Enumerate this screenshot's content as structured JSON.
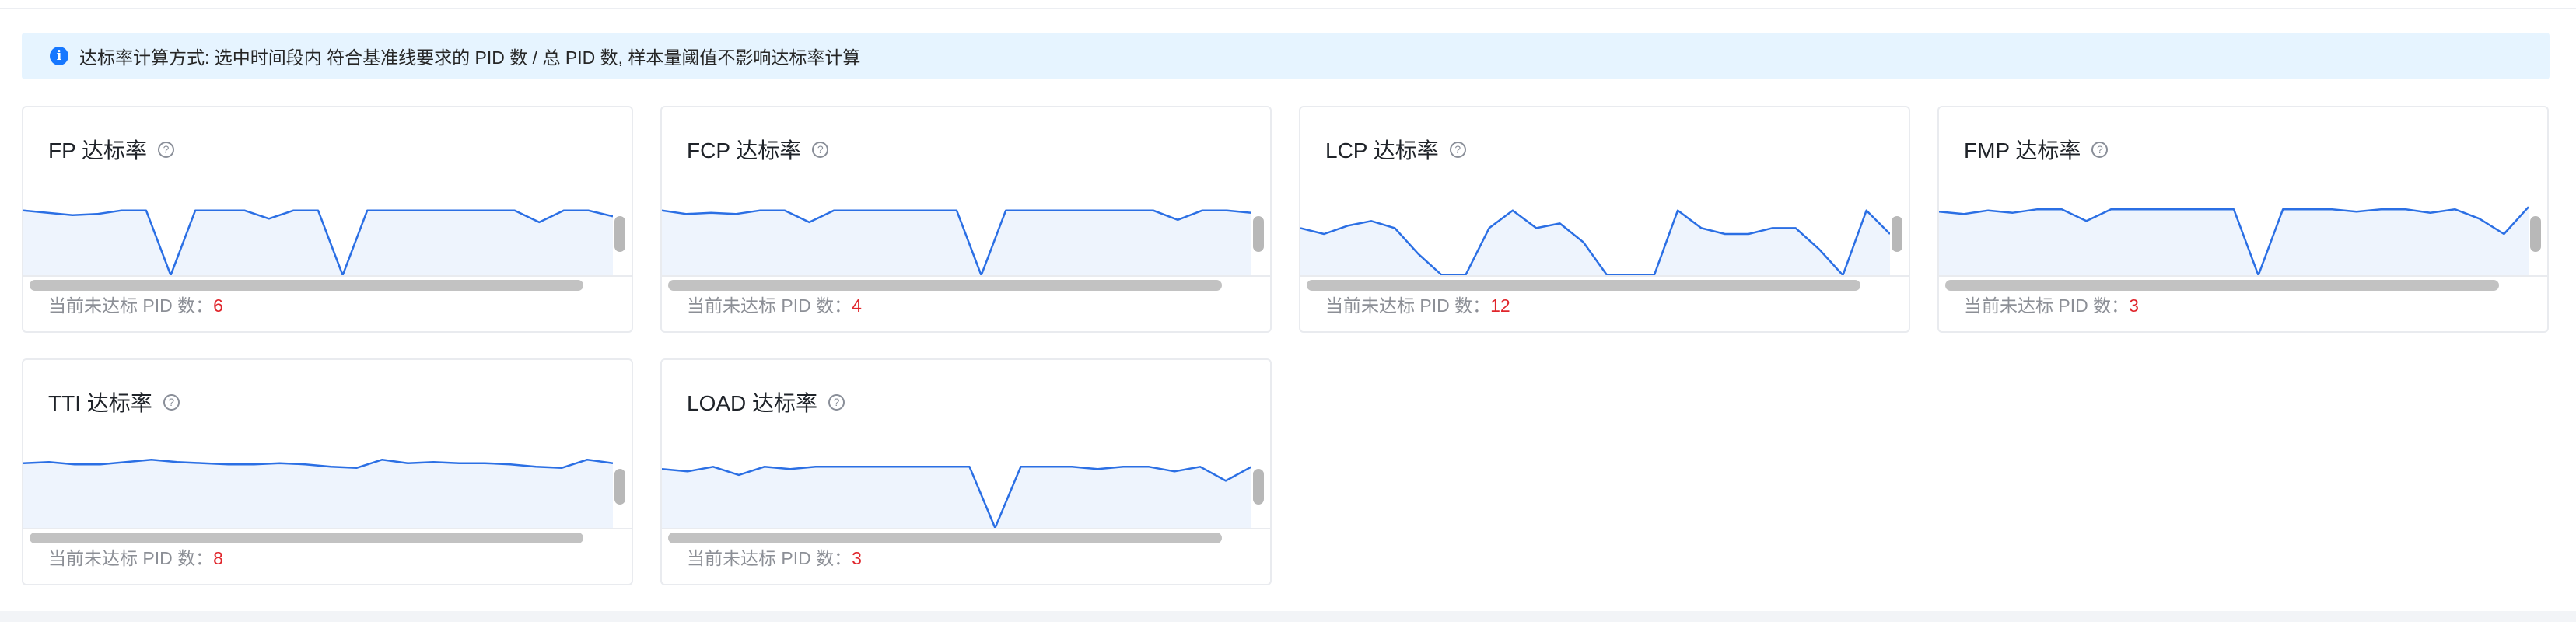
{
  "banner": {
    "icon": "info-icon",
    "text": "达标率计算方式: 选中时间段内 符合基准线要求的 PID 数 / 总 PID 数, 样本量阈值不影响达标率计算"
  },
  "colors": {
    "banner_bg": "#e6f4ff",
    "accent": "#1677ff",
    "line": "#2b6fe4",
    "area": "#eef4fd",
    "count": "#e0252b"
  },
  "help_icon_glyph": "?",
  "footer_label": "当前未达标 PID 数：",
  "cards": [
    {
      "title": "FP 达标率",
      "count": "6",
      "series": [
        55,
        53,
        51,
        52,
        55,
        55,
        0,
        55,
        55,
        55,
        48,
        55,
        55,
        0,
        55,
        55,
        55,
        55,
        55,
        55,
        55,
        45,
        55,
        55,
        50
      ]
    },
    {
      "title": "FCP 达标率",
      "count": "4",
      "series": [
        55,
        52,
        53,
        52,
        55,
        55,
        45,
        55,
        55,
        55,
        55,
        55,
        55,
        0,
        55,
        55,
        55,
        55,
        55,
        55,
        55,
        47,
        55,
        55,
        53
      ]
    },
    {
      "title": "LCP 达标率",
      "count": "12",
      "series": [
        40,
        35,
        42,
        46,
        40,
        18,
        0,
        0,
        40,
        55,
        40,
        44,
        28,
        0,
        0,
        0,
        55,
        40,
        35,
        35,
        40,
        40,
        22,
        0,
        55,
        35
      ]
    },
    {
      "title": "FMP 达标率",
      "count": "3",
      "series": [
        54,
        52,
        55,
        53,
        56,
        56,
        46,
        56,
        56,
        56,
        56,
        56,
        56,
        0,
        56,
        56,
        56,
        54,
        56,
        56,
        53,
        56,
        48,
        35,
        58
      ]
    },
    {
      "title": "TTI 达标率",
      "count": "8",
      "series": [
        55,
        56,
        54,
        54,
        56,
        58,
        56,
        55,
        54,
        54,
        55,
        54,
        52,
        51,
        58,
        55,
        56,
        55,
        55,
        54,
        52,
        51,
        58,
        55
      ]
    },
    {
      "title": "LOAD 达标率",
      "count": "3",
      "series": [
        50,
        48,
        52,
        45,
        52,
        50,
        52,
        52,
        52,
        52,
        52,
        52,
        52,
        0,
        52,
        52,
        52,
        50,
        52,
        52,
        48,
        52,
        40,
        52
      ]
    }
  ]
}
